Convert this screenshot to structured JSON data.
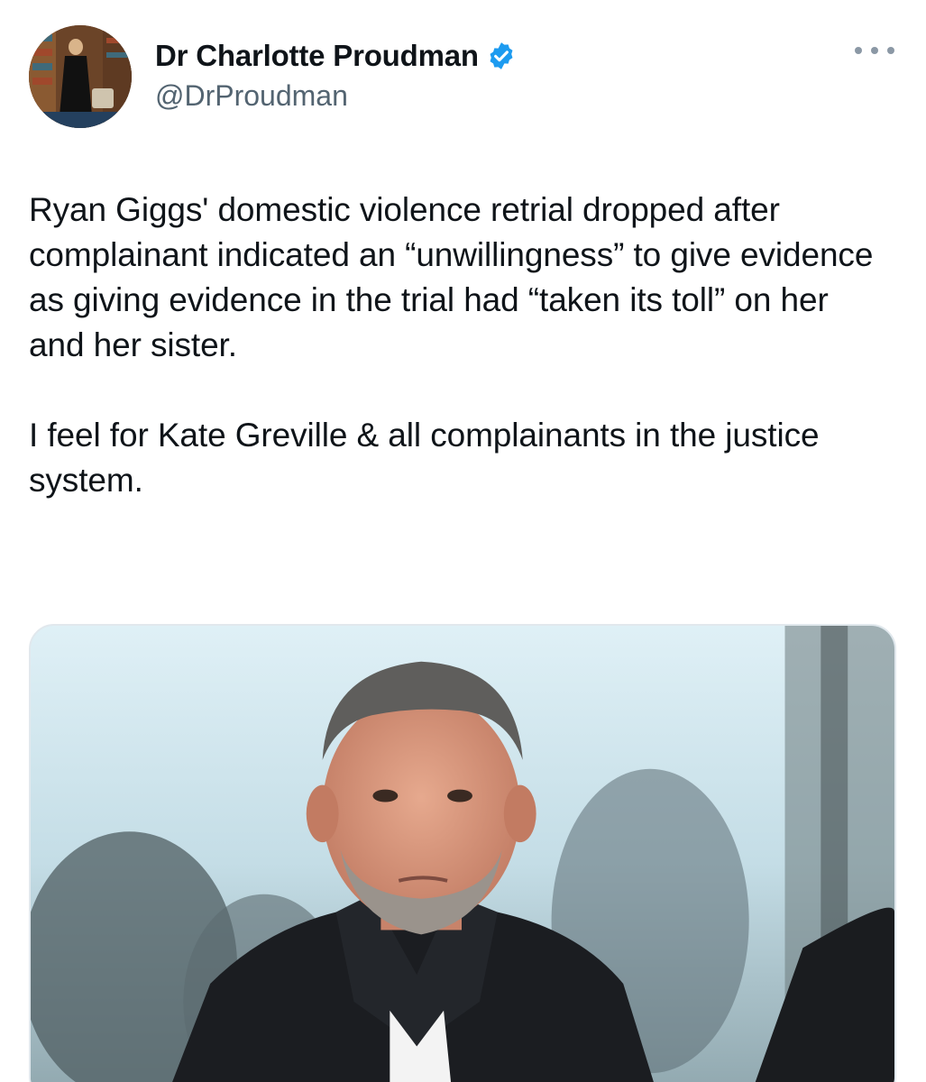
{
  "tweet": {
    "author": {
      "display_name": "Dr Charlotte Proudman",
      "handle": "@DrProudman",
      "verified": true,
      "verified_color": "#1d9bf0",
      "avatar_icon": "profile-photo-avatar"
    },
    "more_icon": "more-options-icon",
    "text": "Ryan Giggs' domestic violence retrial dropped after complainant indicated an “unwillingness” to give evidence as giving evidence in the trial had “taken its toll” on her and her sister.\n\nI feel for Kate Greville & all complainants in the justice system.",
    "media": {
      "type": "photo",
      "subject": "man-in-dark-jacket-photo"
    }
  },
  "colors": {
    "text_primary": "#0f1419",
    "text_secondary": "#536471",
    "accent": "#1d9bf0",
    "border": "#e1e8ed"
  }
}
